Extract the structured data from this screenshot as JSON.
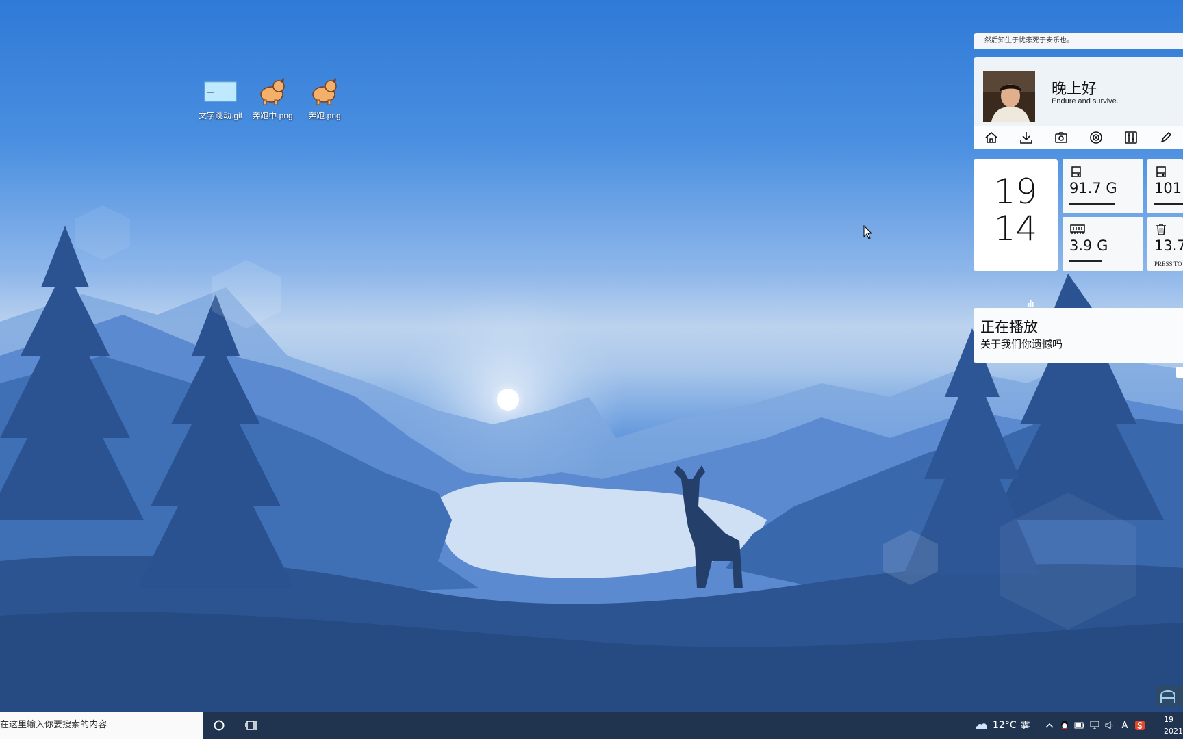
{
  "desktop": {
    "icons": [
      {
        "label": "文字跳动.gif",
        "icon": "gif-file-icon"
      },
      {
        "label": "奔跑中.png",
        "icon": "dog-image-icon"
      },
      {
        "label": "奔跑.png",
        "icon": "dog-image-icon"
      }
    ]
  },
  "widgets": {
    "quote": "然后知生于忧患死于安乐也。",
    "greeting": "晚上好",
    "motto": "Endure and survive.",
    "quick_icons": [
      "home-icon",
      "download-icon",
      "camera-icon",
      "disc-icon",
      "sliders-icon",
      "edit-icon"
    ],
    "clock": {
      "hour": "19",
      "minute": "14"
    },
    "stats": [
      {
        "icon": "drive-icon",
        "value": "91.7 G",
        "fill": 0.55
      },
      {
        "icon": "drive-icon",
        "value": "101.",
        "fill": 0.7
      },
      {
        "icon": "memory-icon",
        "value": "3.9 G",
        "fill": 0.45
      },
      {
        "icon": "trash-icon",
        "value": "13.7",
        "sub": "PRESS TO"
      }
    ],
    "player": {
      "title": "正在播放",
      "song": "关于我们你遗憾吗"
    }
  },
  "taskbar": {
    "search_placeholder": "在这里输入你要搜索的内容",
    "weather": {
      "temp": "12°C",
      "condition": "雾"
    },
    "tray_icons": [
      "chevron-up-icon",
      "qq-icon",
      "battery-icon",
      "network-icon",
      "volume-icon",
      "ime-icon",
      "sogou-icon"
    ],
    "ime_label": "A",
    "time": "19",
    "date": "2021"
  }
}
